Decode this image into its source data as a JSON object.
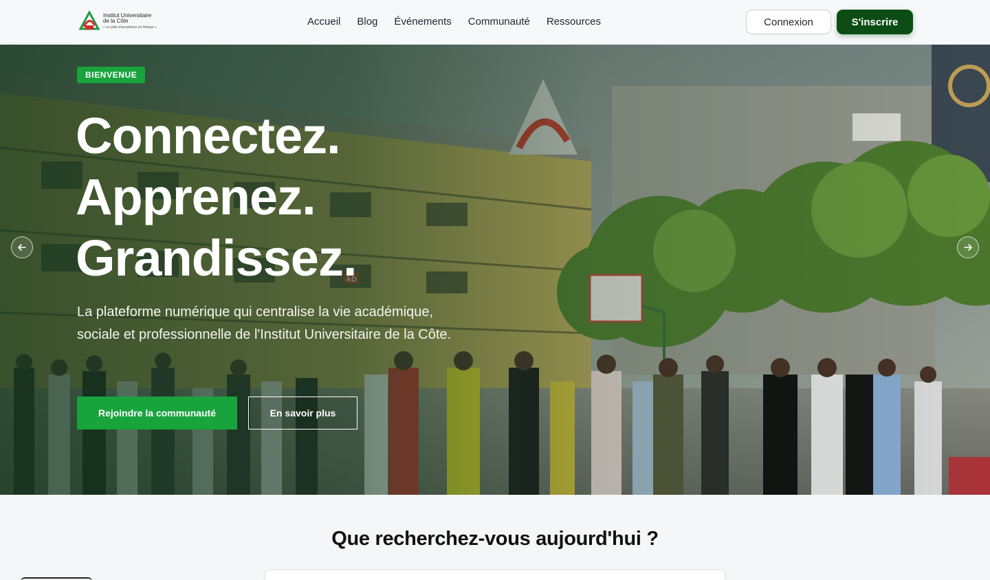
{
  "header": {
    "logo": {
      "line1": "Institut Universitaire",
      "line2": "de la Côte",
      "tagline": "« un pôle d'excellence en Afrique »",
      "colors": {
        "red": "#d42a2a",
        "green": "#1f9a46",
        "gray": "#8a8a8a"
      }
    },
    "nav": [
      {
        "label": "Accueil"
      },
      {
        "label": "Blog"
      },
      {
        "label": "Événements"
      },
      {
        "label": "Communauté"
      },
      {
        "label": "Ressources"
      }
    ],
    "login_label": "Connexion",
    "signup_label": "S'inscrire"
  },
  "hero": {
    "badge": "BIENVENUE",
    "headline": [
      "Connectez.",
      "Apprenez.",
      "Grandissez."
    ],
    "subtitle": "La plateforme numérique qui centralise la vie académique, sociale et professionnelle de l'Institut Universitaire de la Côte.",
    "cta_primary": "Rejoindre la communauté",
    "cta_secondary": "En savoir plus",
    "prev_icon": "arrow-left-icon",
    "next_icon": "arrow-right-icon",
    "image_sign": "AD"
  },
  "search": {
    "title": "Que recherchez-vous aujourd'hui ?"
  },
  "colors": {
    "brand_green": "#18a33d",
    "dark_green": "#0b4d15"
  }
}
